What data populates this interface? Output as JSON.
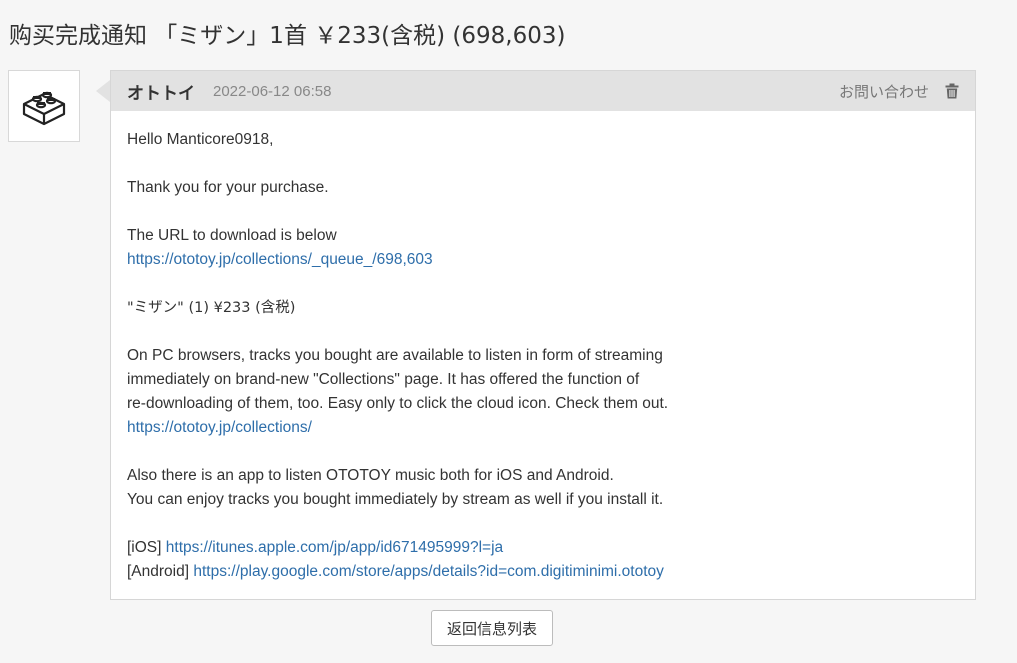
{
  "page": {
    "title": "购买完成通知 「ミザン」1首 ￥233(含税) (698,603)"
  },
  "message": {
    "sender": "オトトイ",
    "timestamp": "2022-06-12 06:58",
    "contact_label": "お問い合わせ",
    "trash_icon": "trash-icon",
    "avatar_icon": "lego-brick-icon",
    "body": {
      "greeting": "Hello Manticore0918,",
      "thanks": "Thank you for your purchase.",
      "url_intro": "The URL to download is below",
      "download_url": "https://ototoy.jp/collections/_queue_/698,603",
      "item_line": "\"ミザン\" (1) ¥233 (含税)",
      "pc_line1": "On PC browsers, tracks you bought are available to listen in form of streaming",
      "pc_line2": "immediately on brand-new \"Collections\" page. It has offered the function of",
      "pc_line3": "re-downloading of them, too. Easy only to click the cloud icon. Check them out.",
      "collections_url": "https://ototoy.jp/collections/",
      "app_line1": "Also there is an app to listen OTOTOY music both for iOS and Android.",
      "app_line2": "You can enjoy tracks you bought immediately by stream as well if you install it.",
      "ios_label": "[iOS]",
      "ios_url": "https://itunes.apple.com/jp/app/id671495999?l=ja",
      "android_label": "[Android]",
      "android_url": "https://play.google.com/store/apps/details?id=com.digitiminimi.ototoy"
    }
  },
  "back_button": {
    "label": "返回信息列表"
  }
}
